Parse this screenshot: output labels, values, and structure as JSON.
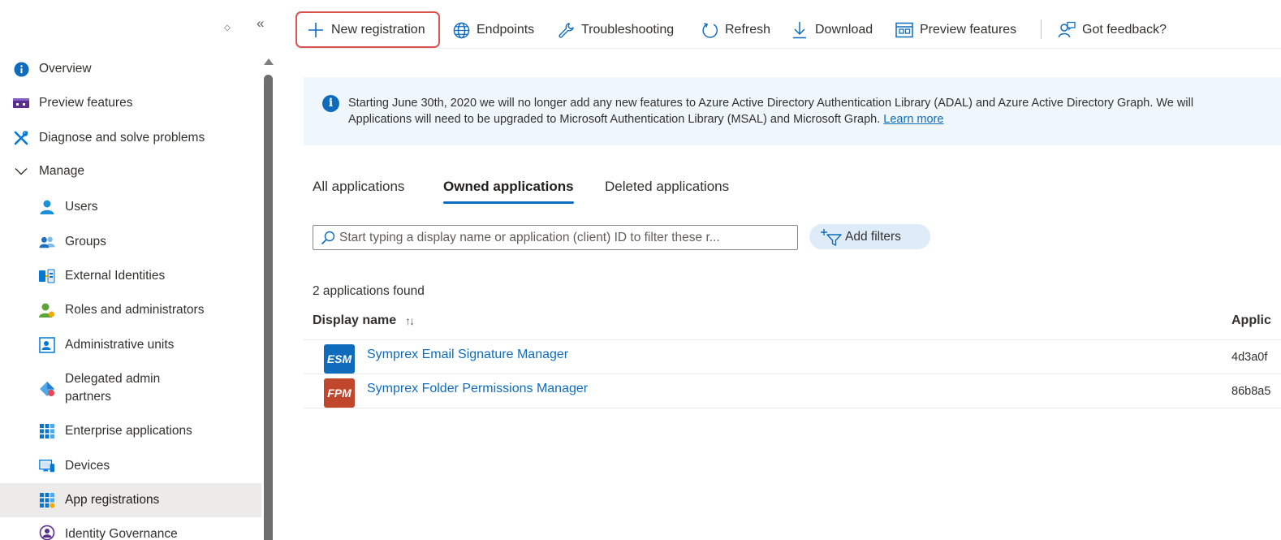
{
  "sidebar": {
    "items": [
      {
        "label": "Overview",
        "icon": "info-icon",
        "level": 0
      },
      {
        "label": "Preview features",
        "icon": "preview-features-icon",
        "level": 0
      },
      {
        "label": "Diagnose and solve problems",
        "icon": "wrench-cross-icon",
        "level": 0
      },
      {
        "label": "Manage",
        "icon": "chevron-down-icon",
        "level": 0
      },
      {
        "label": "Users",
        "icon": "user-icon",
        "level": 1
      },
      {
        "label": "Groups",
        "icon": "group-icon",
        "level": 1
      },
      {
        "label": "External Identities",
        "icon": "external-identities-icon",
        "level": 1
      },
      {
        "label": "Roles and administrators",
        "icon": "roles-icon",
        "level": 1
      },
      {
        "label": "Administrative units",
        "icon": "admin-units-icon",
        "level": 1
      },
      {
        "label": "Delegated admin",
        "label2": "partners",
        "icon": "delegated-admin-icon",
        "level": 1
      },
      {
        "label": "Enterprise applications",
        "icon": "enterprise-apps-icon",
        "level": 1
      },
      {
        "label": "Devices",
        "icon": "devices-icon",
        "level": 1
      },
      {
        "label": "App registrations",
        "icon": "app-registrations-icon",
        "level": 1,
        "active": true
      },
      {
        "label": "Identity Governance",
        "icon": "identity-governance-icon",
        "level": 1
      }
    ]
  },
  "toolbar": {
    "new_registration": "New registration",
    "endpoints": "Endpoints",
    "troubleshooting": "Troubleshooting",
    "refresh": "Refresh",
    "download": "Download",
    "preview_features": "Preview features",
    "feedback": "Got feedback?"
  },
  "banner": {
    "line1": "Starting June 30th, 2020 we will no longer add any new features to Azure Active Directory Authentication Library (ADAL) and Azure Active Directory Graph. We will",
    "line2": "Applications will need to be upgraded to Microsoft Authentication Library (MSAL) and Microsoft Graph.",
    "link": "Learn more"
  },
  "tabs": [
    {
      "label": "All applications",
      "active": false
    },
    {
      "label": "Owned applications",
      "active": true
    },
    {
      "label": "Deleted applications",
      "active": false
    }
  ],
  "search": {
    "placeholder": "Start typing a display name or application (client) ID to filter these r..."
  },
  "filters": {
    "add_label": "Add filters"
  },
  "results": {
    "count_text": "2 applications found",
    "columns": [
      "Display name",
      "Applic"
    ],
    "sort_indicator": "↑↓",
    "rows": [
      {
        "logo_text": "ESM",
        "logo_color": "#0f6cbd",
        "name": "Symprex Email Signature Manager",
        "app_id": "4d3a0f"
      },
      {
        "logo_text": "FPM",
        "logo_color": "#c0472c",
        "name": "Symprex Folder Permissions Manager",
        "app_id": "86b8a5"
      }
    ]
  },
  "colors": {
    "accent": "#0f6cbd",
    "highlight_border": "#d9534f",
    "banner_bg": "#eff6fc",
    "active_nav_bg": "#edebe9"
  }
}
